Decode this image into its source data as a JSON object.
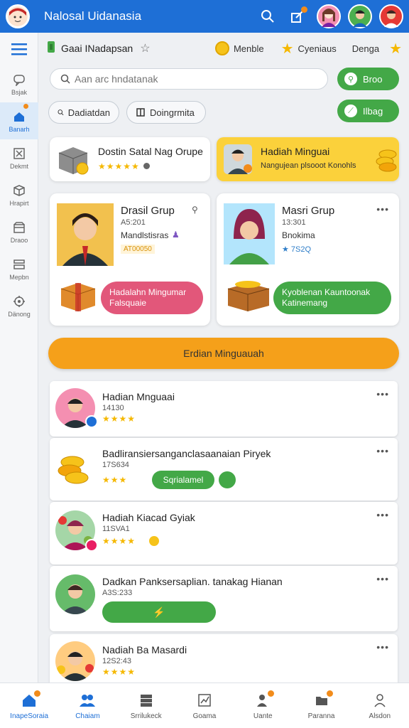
{
  "app": {
    "title": "Nalosal Uidanasia"
  },
  "sidebar": {
    "items": [
      {
        "label": "Bsjak",
        "icon": "chat-icon"
      },
      {
        "label": "Banarh",
        "icon": "home-icon"
      },
      {
        "label": "Dekmt",
        "icon": "square-x-icon"
      },
      {
        "label": "Hrapirt",
        "icon": "cube-icon"
      },
      {
        "label": "Draoo",
        "icon": "box-icon"
      },
      {
        "label": "Mepbn",
        "icon": "layers-icon"
      },
      {
        "label": "Dänong",
        "icon": "gear-icon"
      }
    ]
  },
  "header": {
    "group_name": "Gaai INadapsan",
    "coins_label": "Menble",
    "rank_label": "Cyeniaus",
    "star_label": "Denga"
  },
  "search": {
    "placeholder": "Aan arc hndatanak"
  },
  "actions": {
    "primary_label": "Broo",
    "secondary_label": "Ilbag"
  },
  "chips": [
    {
      "label": "Dadiatdan",
      "icon": "search-icon"
    },
    {
      "label": "Doingrmita",
      "icon": "grid-icon"
    }
  ],
  "promos": [
    {
      "title": "Dostin Satal Nag Orupe",
      "stars": "★★★★★"
    },
    {
      "title": "Hadiah Minguai",
      "subtitle": "Nangujean plsooot Konohls"
    }
  ],
  "groups": [
    {
      "title": "Drasil Grup",
      "time": "A5:201",
      "role": "Mandlstisras",
      "tag": "AT00050",
      "button": "Hadalahn Mingumar\nFalsquaie"
    },
    {
      "title": "Masri Grup",
      "time": "13:301",
      "role": "Bnokima",
      "rating": "★ 7S2Q",
      "button": "Kyoblenan Kauntoonak\nKatinemang"
    }
  ],
  "main_button": {
    "label": "Erdian Minguauah"
  },
  "feed": [
    {
      "title": "Hadian Mnguaai",
      "sub": "14130",
      "stars": "★★★★"
    },
    {
      "title": "Badliransiersanganclasaanaian Piryek",
      "sub": "17S634",
      "stars": "★★★",
      "button": "Sqrialamel"
    },
    {
      "title": "Hadiah Kiacad Gyiak",
      "sub": "11SVA1",
      "stars": "★★★★"
    },
    {
      "title": "Dadkan Panksersaplian. tanakag Hianan",
      "sub": "A3S:233"
    },
    {
      "title": "Nadiah Ba Masardi",
      "sub": "12S2:43",
      "stars": "★★★★"
    }
  ],
  "bottom_nav": [
    {
      "label": "InapeSoraia",
      "icon": "home-icon"
    },
    {
      "label": "Chaiam",
      "icon": "people-icon"
    },
    {
      "label": "Srrilukeck",
      "icon": "stack-icon"
    },
    {
      "label": "Goama",
      "icon": "chart-icon"
    },
    {
      "label": "Uante",
      "icon": "user-add-icon"
    },
    {
      "label": "Paranna",
      "icon": "folder-icon"
    },
    {
      "label": "Alsdon",
      "icon": "person-icon"
    }
  ],
  "colors": {
    "primary": "#1e6fd6",
    "accent": "#f5a01a",
    "success": "#43a847",
    "pink": "#e2577a",
    "yellow": "#fbd13b"
  }
}
